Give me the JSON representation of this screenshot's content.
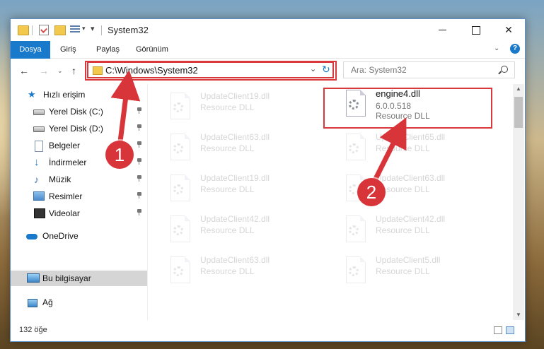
{
  "window": {
    "title": "System32",
    "controls": {
      "minimize": "minimize-icon",
      "maximize": "maximize-icon",
      "close": "✕"
    }
  },
  "quick_access_toolbar": {
    "dropdown": "▾",
    "customize": "▾"
  },
  "ribbon": {
    "tabs": [
      {
        "label": "Dosya",
        "active": true
      },
      {
        "label": "Giriş"
      },
      {
        "label": "Paylaş"
      },
      {
        "label": "Görünüm"
      }
    ],
    "collapse": "⌄",
    "help": "?"
  },
  "navigation": {
    "back": "←",
    "forward": "→",
    "recent": "⌄",
    "up": "↑",
    "address": "C:\\Windows\\System32",
    "address_dropdown": "⌄",
    "refresh": "↻",
    "search_placeholder": "Ara: System32"
  },
  "sidebar": {
    "items": [
      {
        "label": "Hızlı erişim",
        "icon": "star-icon"
      },
      {
        "label": "Yerel Disk (C:)",
        "icon": "disk-icon",
        "pinned": true
      },
      {
        "label": "Yerel Disk (D:)",
        "icon": "disk-icon",
        "pinned": true
      },
      {
        "label": "Belgeler",
        "icon": "document-icon",
        "pinned": true
      },
      {
        "label": "İndirmeler",
        "icon": "download-icon",
        "pinned": true
      },
      {
        "label": "Müzik",
        "icon": "music-icon",
        "pinned": true
      },
      {
        "label": "Resimler",
        "icon": "pictures-icon",
        "pinned": true
      },
      {
        "label": "Videolar",
        "icon": "video-icon",
        "pinned": true
      },
      {
        "label": "OneDrive",
        "icon": "cloud-icon"
      },
      {
        "label": "Bu bilgisayar",
        "icon": "computer-icon",
        "selected": true
      },
      {
        "label": "Ağ",
        "icon": "network-icon"
      }
    ]
  },
  "files": {
    "left_column": [
      {
        "name": "UpdateClient19.dll",
        "type": "Resource DLL"
      },
      {
        "name": "UpdateClient63.dll",
        "type": "Resource DLL"
      },
      {
        "name": "UpdateClient19.dll",
        "type": "Resource DLL"
      },
      {
        "name": "UpdateClient42.dll",
        "type": "Resource DLL"
      },
      {
        "name": "UpdateClient63.dll",
        "type": "Resource DLL"
      }
    ],
    "highlighted": {
      "name": "engine4.dll",
      "version": "6.0.0.518",
      "type": "Resource DLL"
    },
    "right_column": [
      {
        "name": "UpdateClient65.dll",
        "type": "Resource DLL"
      },
      {
        "name": "UpdateClient63.dll",
        "type": "Resource DLL"
      },
      {
        "name": "UpdateClient42.dll",
        "type": "Resource DLL"
      },
      {
        "name": "UpdateClient5.dll",
        "type": "Resource DLL"
      }
    ]
  },
  "status": {
    "item_count": "132 öğe"
  },
  "annotations": {
    "step1": "1",
    "step2": "2",
    "color": "#d8353a"
  }
}
